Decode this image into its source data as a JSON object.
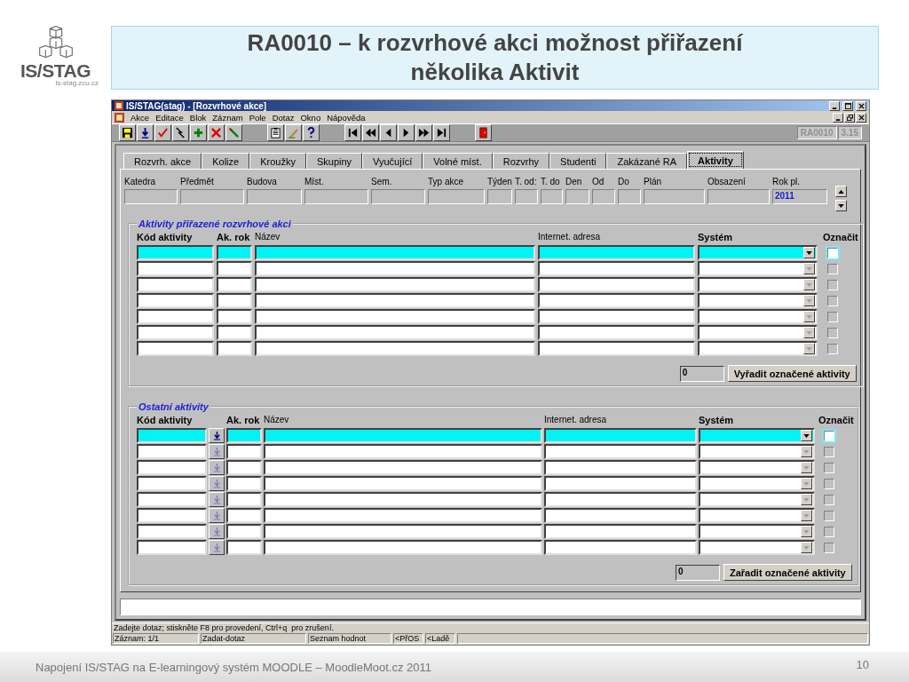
{
  "logo": {
    "text": "IS/STAG",
    "url": "is-stag.zcu.cz"
  },
  "slide_title": [
    "RA0010 – k rozvrhové akci možnost přiřazení",
    "několika Aktivit"
  ],
  "window": {
    "title": "IS/STAG(stag) - [Rozvrhové akce]",
    "menu": [
      "Akce",
      "Editace",
      "Blok",
      "Záznam",
      "Pole",
      "Dotaz",
      "Okno",
      "Nápověda"
    ],
    "form_code": "RA0010",
    "version": "3.15",
    "tabs": [
      {
        "label": "Rozvrh. akce",
        "selected": false
      },
      {
        "label": "Kolize",
        "selected": false
      },
      {
        "label": "Kroužky",
        "selected": false
      },
      {
        "label": "Skupiny",
        "selected": false
      },
      {
        "label": "Vyučující",
        "selected": false
      },
      {
        "label": "Volné míst.",
        "selected": false
      },
      {
        "label": "Rozvrhy",
        "selected": false
      },
      {
        "label": "Studenti",
        "selected": false
      },
      {
        "label": "Zakázané RA",
        "selected": false
      },
      {
        "label": "Aktivity",
        "selected": true
      }
    ],
    "header_fields": [
      {
        "label": "Katedra"
      },
      {
        "label": "Předmět"
      },
      {
        "label": "Budova"
      },
      {
        "label": "Míst."
      },
      {
        "label": "Sem."
      },
      {
        "label": "Typ akce"
      },
      {
        "label": "Týden"
      },
      {
        "label": "T. od:"
      },
      {
        "label": "T. do"
      },
      {
        "label": "Den"
      },
      {
        "label": "Od"
      },
      {
        "label": "Do"
      },
      {
        "label": "Plán"
      },
      {
        "label": "Obsazení"
      },
      {
        "label": "Rok pl.",
        "value": "2011"
      }
    ],
    "sections": [
      {
        "title": "Aktivity přiřazené rozvrhové akci",
        "lov": false,
        "columns": [
          {
            "label": "Kód aktivity",
            "bold": true
          },
          {
            "label": "Ak. rok",
            "bold": true
          },
          {
            "label": "Název",
            "bold": false
          },
          {
            "label": "Internet. adresa",
            "bold": false
          },
          {
            "label": "Systém",
            "bold": true
          },
          {
            "label": "Označit",
            "bold": true
          }
        ],
        "rows": [
          {
            "selected": true,
            "checked": false
          },
          {
            "selected": false,
            "checked": false
          },
          {
            "selected": false,
            "checked": false
          },
          {
            "selected": false,
            "checked": false
          },
          {
            "selected": false,
            "checked": false
          },
          {
            "selected": false,
            "checked": false
          },
          {
            "selected": false,
            "checked": false
          }
        ],
        "count": "0",
        "button": "Vyřadit označené aktivity"
      },
      {
        "title": "Ostatní aktivity",
        "lov": true,
        "columns": [
          {
            "label": "Kód aktivity",
            "bold": true
          },
          {
            "label": "Ak. rok",
            "bold": true
          },
          {
            "label": "Název",
            "bold": false
          },
          {
            "label": "Internet. adresa",
            "bold": false
          },
          {
            "label": "Systém",
            "bold": true
          },
          {
            "label": "Označit",
            "bold": true
          }
        ],
        "rows": [
          {
            "selected": true,
            "checked": false
          },
          {
            "selected": false,
            "checked": false
          },
          {
            "selected": false,
            "checked": false
          },
          {
            "selected": false,
            "checked": false
          },
          {
            "selected": false,
            "checked": false
          },
          {
            "selected": false,
            "checked": false
          },
          {
            "selected": false,
            "checked": false
          },
          {
            "selected": false,
            "checked": false
          }
        ],
        "count": "0",
        "button": "Zařadit označené aktivity"
      }
    ],
    "message": "Zadejte dotaz; stiskněte F8 pro provedení, Ctrl+q  pro zrušení.",
    "status_bar": [
      "Záznam: 1/1",
      "Zadat-dotaz",
      "Seznam hodnot",
      "<PřOS",
      "<Ladě"
    ]
  },
  "footer": {
    "text": "Napojení IS/STAG na E-learningový systém MOODLE – MoodleMoot.cz 2011",
    "page": "10"
  }
}
